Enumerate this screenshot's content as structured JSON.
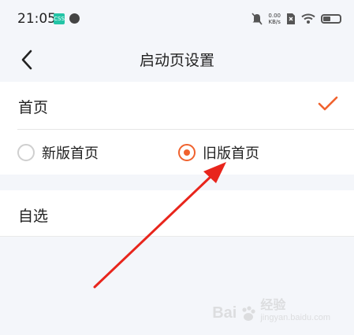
{
  "status_bar": {
    "time": "21:05",
    "app_badge": "CSS",
    "net_speed_value": "0.00",
    "net_speed_unit": "KB/s"
  },
  "header": {
    "title": "启动页设置"
  },
  "home_section": {
    "label": "首页",
    "options": [
      {
        "label": "新版首页",
        "selected": false
      },
      {
        "label": "旧版首页",
        "selected": true
      }
    ]
  },
  "watchlist_section": {
    "label": "自选"
  },
  "watermark": {
    "main": "Bai",
    "main2": "经验",
    "sub": "jingyan.baidu.com"
  },
  "colors": {
    "accent": "#f0622e",
    "arrow": "#e8251c",
    "background": "#f4f6fa"
  }
}
